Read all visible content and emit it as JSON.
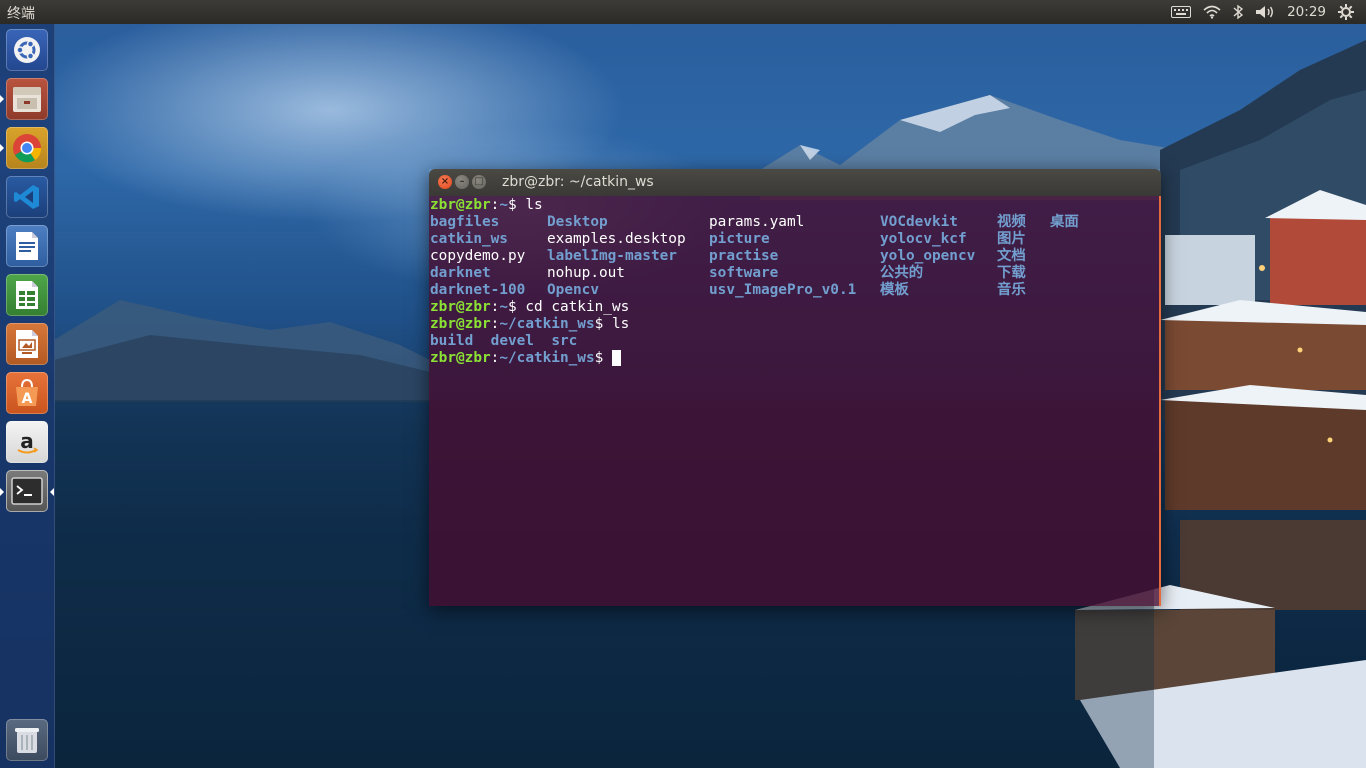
{
  "panel": {
    "app_title": "终端",
    "clock": "20:29",
    "indicators": [
      "keyboard-icon",
      "wifi-icon",
      "bluetooth-icon",
      "volume-icon",
      "gear-icon"
    ]
  },
  "launcher": {
    "items": [
      {
        "name": "ubuntu-dash-icon",
        "running": false
      },
      {
        "name": "file-manager-icon",
        "running": true
      },
      {
        "name": "chrome-icon",
        "running": true
      },
      {
        "name": "vscode-icon",
        "running": false
      },
      {
        "name": "libreoffice-writer-icon",
        "running": false
      },
      {
        "name": "libreoffice-calc-icon",
        "running": false
      },
      {
        "name": "libreoffice-impress-icon",
        "running": false
      },
      {
        "name": "software-center-icon",
        "running": false
      },
      {
        "name": "amazon-icon",
        "running": false
      },
      {
        "name": "terminal-icon",
        "running": true,
        "focused": true
      },
      {
        "name": "trash-icon",
        "running": false
      }
    ]
  },
  "terminal": {
    "title": "zbr@zbr: ~/catkin_ws",
    "colors": {
      "user": "#8ae234",
      "path": "#729fcf",
      "dir": "#729fcf",
      "text": "#ffffff",
      "background": "#460c30"
    },
    "commands": [
      {
        "user": "zbr@zbr",
        "path": "~",
        "suffix": "$ ls"
      },
      {
        "user": "zbr@zbr",
        "path": "~",
        "suffix": "$ cd catkin_ws"
      },
      {
        "user": "zbr@zbr",
        "path": "~/catkin_ws",
        "suffix": "$ ls"
      },
      {
        "user": "zbr@zbr",
        "path": "~/catkin_ws",
        "suffix": "$ "
      }
    ],
    "home_listing": [
      {
        "name": "bagfiles",
        "type": "dir"
      },
      {
        "name": "catkin_ws",
        "type": "dir"
      },
      {
        "name": "copydemo.py",
        "type": "file"
      },
      {
        "name": "darknet",
        "type": "dir"
      },
      {
        "name": "darknet-100",
        "type": "dir"
      },
      {
        "name": "Desktop",
        "type": "dir"
      },
      {
        "name": "examples.desktop",
        "type": "file"
      },
      {
        "name": "labelImg-master",
        "type": "dir"
      },
      {
        "name": "nohup.out",
        "type": "file"
      },
      {
        "name": "Opencv",
        "type": "dir"
      },
      {
        "name": "params.yaml",
        "type": "file"
      },
      {
        "name": "picture",
        "type": "dir"
      },
      {
        "name": "practise",
        "type": "dir"
      },
      {
        "name": "software",
        "type": "dir"
      },
      {
        "name": "usv_ImagePro_v0.1",
        "type": "dir"
      },
      {
        "name": "VOCdevkit",
        "type": "dir"
      },
      {
        "name": "yolocv_kcf",
        "type": "dir"
      },
      {
        "name": "yolo_opencv",
        "type": "dir"
      },
      {
        "name": "公共的",
        "type": "dir"
      },
      {
        "name": "模板",
        "type": "dir"
      },
      {
        "name": "视频",
        "type": "dir"
      },
      {
        "name": "图片",
        "type": "dir"
      },
      {
        "name": "文档",
        "type": "dir"
      },
      {
        "name": "下载",
        "type": "dir"
      },
      {
        "name": "音乐",
        "type": "dir"
      },
      {
        "name": "桌面",
        "type": "dir"
      }
    ],
    "catkin_listing": [
      {
        "name": "build",
        "type": "dir"
      },
      {
        "name": "devel",
        "type": "dir"
      },
      {
        "name": "src",
        "type": "dir"
      }
    ]
  }
}
